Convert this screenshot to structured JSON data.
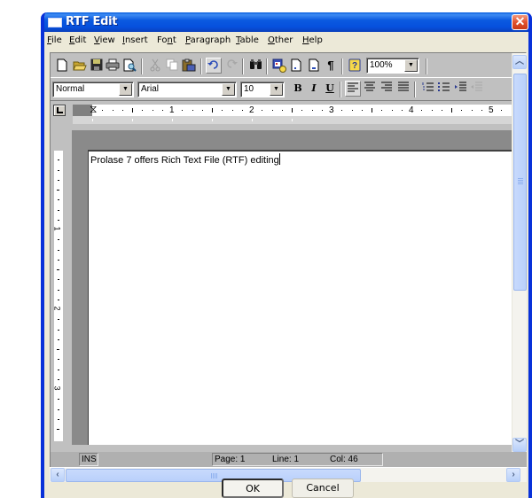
{
  "window": {
    "title": "RTF Edit",
    "close_symbol": "✕"
  },
  "menu": [
    {
      "label": "File",
      "mnemonic": "F"
    },
    {
      "label": "Edit",
      "mnemonic": "E"
    },
    {
      "label": "View",
      "mnemonic": "V"
    },
    {
      "label": "Insert",
      "mnemonic": "I"
    },
    {
      "label": "Font",
      "mnemonic": "n"
    },
    {
      "label": "Paragraph",
      "mnemonic": "P"
    },
    {
      "label": "Table",
      "mnemonic": "T"
    },
    {
      "label": "Other",
      "mnemonic": "O"
    },
    {
      "label": "Help",
      "mnemonic": "H"
    }
  ],
  "toolbar": {
    "row1": [
      {
        "name": "new-document",
        "icon": "new-document-icon",
        "enabled": true
      },
      {
        "name": "open",
        "icon": "open-folder-icon",
        "enabled": true
      },
      {
        "name": "save",
        "icon": "save-disk-icon",
        "enabled": true
      },
      {
        "name": "print",
        "icon": "printer-icon",
        "enabled": true
      },
      {
        "name": "print-preview",
        "icon": "print-preview-icon",
        "enabled": true
      },
      {
        "name": "cut",
        "icon": "scissors-icon",
        "enabled": false
      },
      {
        "name": "copy",
        "icon": "copy-icon",
        "enabled": false
      },
      {
        "name": "paste",
        "icon": "paste-clipboard-icon",
        "enabled": true
      },
      {
        "name": "undo",
        "icon": "undo-arrow-icon",
        "enabled": true,
        "pressed": true
      },
      {
        "name": "redo",
        "icon": "redo-arrow-icon",
        "enabled": false
      },
      {
        "name": "find",
        "icon": "binoculars-icon",
        "enabled": true
      },
      {
        "name": "insert-date-time",
        "icon": "calendar-clock-icon",
        "enabled": true
      },
      {
        "name": "insert-page",
        "icon": "page-icon",
        "enabled": true
      },
      {
        "name": "insert-page-number",
        "icon": "page-number-icon",
        "enabled": true
      },
      {
        "name": "show-formatting",
        "icon": "pilcrow-icon",
        "symbol": "¶",
        "enabled": true
      },
      {
        "name": "help",
        "icon": "help-question-icon",
        "symbol": "?",
        "enabled": true
      }
    ],
    "zoom_value": "100%",
    "style_value": "Normal",
    "font_value": "Arial",
    "size_value": "10",
    "format_buttons": [
      {
        "name": "bold",
        "symbol": "B"
      },
      {
        "name": "italic",
        "symbol": "I"
      },
      {
        "name": "underline",
        "symbol": "U"
      }
    ],
    "align_buttons": [
      "align-left",
      "align-center",
      "align-right",
      "justify"
    ],
    "list_buttons": [
      "numbered-list",
      "bulleted-list",
      "increase-indent",
      "decrease-indent"
    ]
  },
  "ruler": {
    "h_numbers": [
      "1",
      "2",
      "3",
      "4",
      "5"
    ],
    "v_numbers": [
      "1",
      "2",
      "3"
    ]
  },
  "document": {
    "text": "Prolase 7 offers Rich Text File (RTF) editing"
  },
  "status": {
    "mode": "INS",
    "page": "Page: 1",
    "line": "Line: 1",
    "col": "Col: 46"
  },
  "buttons": {
    "ok": "OK",
    "cancel": "Cancel"
  }
}
